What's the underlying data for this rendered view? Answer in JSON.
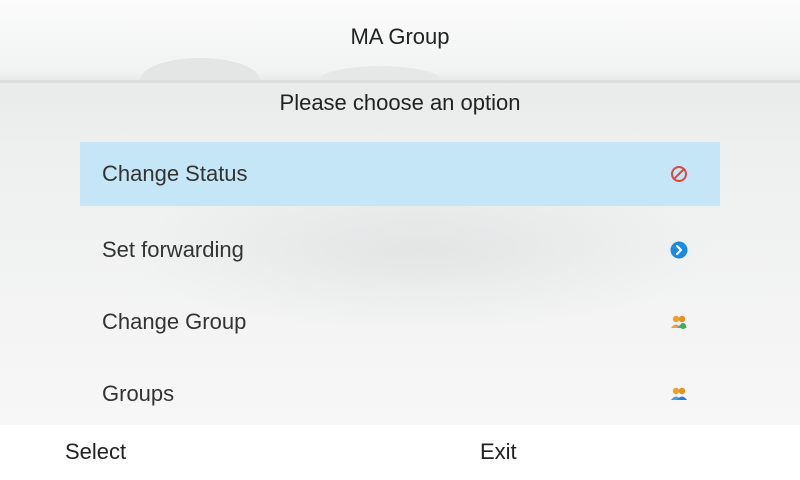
{
  "header": {
    "title": "MA Group",
    "prompt": "Please choose an option"
  },
  "menu": {
    "selected_index": 0,
    "items": [
      {
        "label": "Change Status",
        "icon": "do-not-disturb-icon",
        "icon_color": "#e0443a"
      },
      {
        "label": "Set forwarding",
        "icon": "forward-arrow-icon",
        "icon_color": "#1a8be0"
      },
      {
        "label": "Change Group",
        "icon": "group-people-icon",
        "icon_color": "#f0a030"
      },
      {
        "label": "Groups",
        "icon": "group-people-icon",
        "icon_color": "#f0a030"
      }
    ]
  },
  "softkeys": {
    "left": "Select",
    "right": "Exit"
  },
  "colors": {
    "selection": "#c5e6f6",
    "softkey_bar": "#ffffff"
  }
}
